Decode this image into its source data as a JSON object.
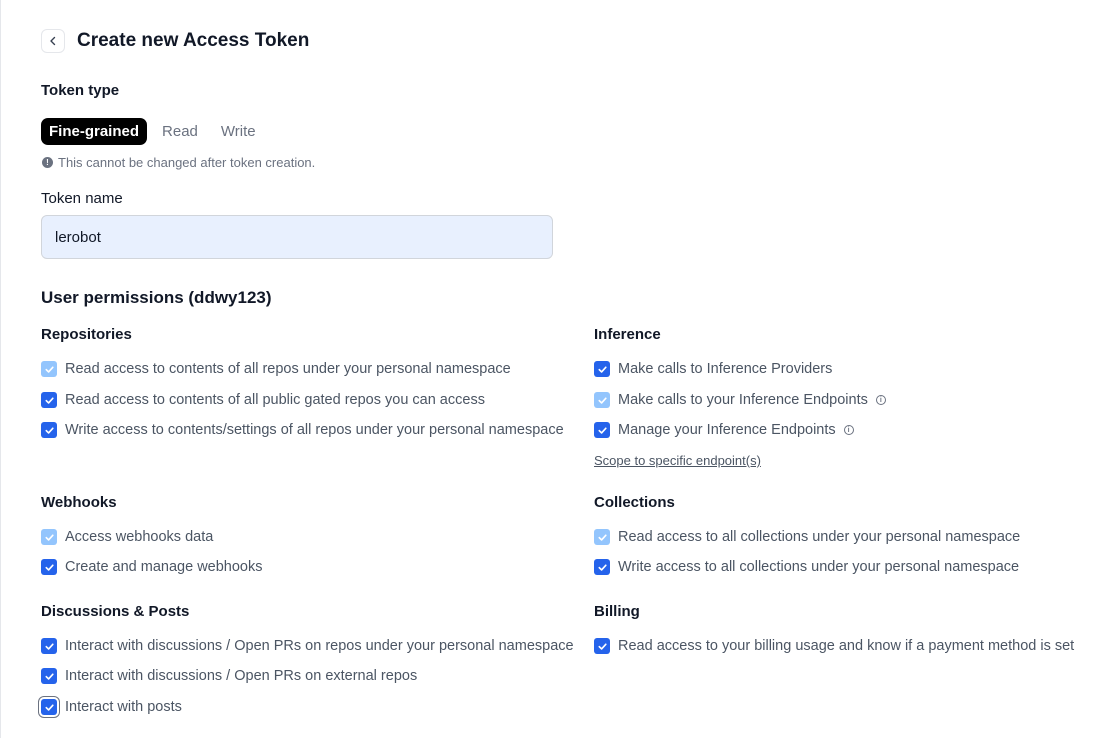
{
  "header": {
    "title": "Create new Access Token"
  },
  "token_type": {
    "label": "Token type",
    "tabs": [
      {
        "label": "Fine-grained",
        "active": true
      },
      {
        "label": "Read",
        "active": false
      },
      {
        "label": "Write",
        "active": false
      }
    ],
    "note": "This cannot be changed after token creation."
  },
  "token_name": {
    "label": "Token name",
    "value": "lerobot"
  },
  "permissions": {
    "heading": "User permissions (ddwy123)",
    "repositories": {
      "title": "Repositories",
      "items": [
        {
          "label": "Read access to contents of all repos under your personal namespace",
          "checked": true,
          "disabled": true
        },
        {
          "label": "Read access to contents of all public gated repos you can access",
          "checked": true,
          "disabled": false
        },
        {
          "label": "Write access to contents/settings of all repos under your personal namespace",
          "checked": true,
          "disabled": false
        }
      ]
    },
    "inference": {
      "title": "Inference",
      "items": [
        {
          "label": "Make calls to Inference Providers",
          "checked": true,
          "disabled": false
        },
        {
          "label": "Make calls to your Inference Endpoints",
          "checked": true,
          "disabled": true
        },
        {
          "label": "Manage your Inference Endpoints",
          "checked": true,
          "disabled": false
        }
      ],
      "scope_link": "Scope to specific endpoint(s)"
    },
    "webhooks": {
      "title": "Webhooks",
      "items": [
        {
          "label": "Access webhooks data",
          "checked": true,
          "disabled": true
        },
        {
          "label": "Create and manage webhooks",
          "checked": true,
          "disabled": false
        }
      ]
    },
    "collections": {
      "title": "Collections",
      "items": [
        {
          "label": "Read access to all collections under your personal namespace",
          "checked": true,
          "disabled": true
        },
        {
          "label": "Write access to all collections under your personal namespace",
          "checked": true,
          "disabled": false
        }
      ]
    },
    "discussions": {
      "title": "Discussions & Posts",
      "items": [
        {
          "label": "Interact with discussions / Open PRs on repos under your personal namespace",
          "checked": true,
          "disabled": false
        },
        {
          "label": "Interact with discussions / Open PRs on external repos",
          "checked": true,
          "disabled": false
        },
        {
          "label": "Interact with posts",
          "checked": true,
          "disabled": false
        }
      ]
    },
    "billing": {
      "title": "Billing",
      "items": [
        {
          "label": "Read access to your billing usage and know if a payment method is set",
          "checked": true,
          "disabled": false
        }
      ]
    }
  },
  "icons": {
    "back": "chevron-left-icon",
    "info": "info-circle-icon",
    "check": "checkmark-icon"
  },
  "colors": {
    "checkbox": "#2563eb",
    "checkbox_disabled": "#93c5fd",
    "input_bg": "#e8f0fe",
    "active_tab_bg": "#000000"
  }
}
